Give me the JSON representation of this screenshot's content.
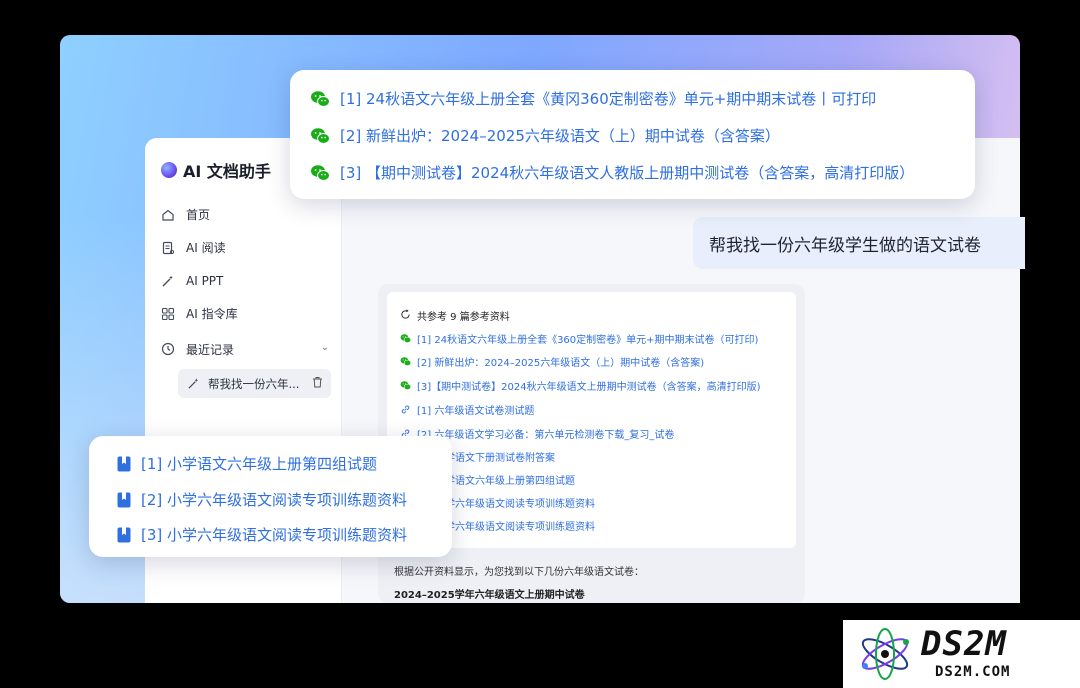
{
  "app": {
    "name": "AI 文档助手"
  },
  "sidebar": {
    "items": [
      {
        "label": "首页",
        "icon": "home-icon"
      },
      {
        "label": "AI 阅读",
        "icon": "reading-icon"
      },
      {
        "label": "AI PPT",
        "icon": "magic-wand-icon"
      },
      {
        "label": "AI 指令库",
        "icon": "command-library-icon"
      }
    ],
    "recent_label": "最近记录",
    "recent_item": "帮我找一份六年..."
  },
  "chat": {
    "user_message": "帮我找一份六年级学生做的语文试卷",
    "references": {
      "header": "共参考 9 篇参考资料",
      "items": [
        {
          "type": "wechat",
          "text": "[1] 24秋语文六年级上册全套《360定制密卷》单元+期中期末试卷（可打印)"
        },
        {
          "type": "wechat",
          "text": "[2] 新鲜出炉：2024–2025六年级语文（上）期中试卷（含答案)"
        },
        {
          "type": "wechat",
          "text": "[3]【期中测试卷】2024秋六年级语文上册期中测试卷（含答案，高清打印版)"
        },
        {
          "type": "link",
          "text": "[1] 六年级语文试卷测试题"
        },
        {
          "type": "link",
          "text": "[2] 六年级语文学习必备：第六单元检测卷下载_复习_试卷"
        },
        {
          "type": "doc",
          "text": "学语文下册测试卷附答案"
        },
        {
          "type": "doc",
          "text": "学语文六年级上册第四组试题"
        },
        {
          "type": "doc",
          "text": "学六年级语文阅读专项训练题资料"
        },
        {
          "type": "doc",
          "text": "学六年级语文阅读专项训练题资料"
        }
      ]
    },
    "answer_intro": "根据公开资料显示，为您找到以下几份六年级语文试卷：",
    "answer_heading": "2024–2025学年六年级语文上册期中试卷"
  },
  "popup_wechat": {
    "items": [
      "[1] 24秋语文六年级上册全套《黄冈360定制密卷》单元+期中期末试卷丨可打印",
      "[2] 新鲜出炉：2024–2025六年级语文（上）期中试卷（含答案）",
      "[3] 【期中测试卷】2024秋六年级语文人教版上册期中测试卷（含答案，高清打印版）"
    ],
    "icon": "wechat-icon",
    "color": "#2f6fe0"
  },
  "popup_docs": {
    "items": [
      "[1] 小学语文六年级上册第四组试题",
      "[2] 小学六年级语文阅读专项训练题资料",
      "[3] 小学六年级语文阅读专项训练题资料"
    ],
    "icon": "document-icon",
    "color": "#2f6fe0"
  },
  "watermark": {
    "main": "DS2M",
    "sub": "DS2M.COM"
  }
}
